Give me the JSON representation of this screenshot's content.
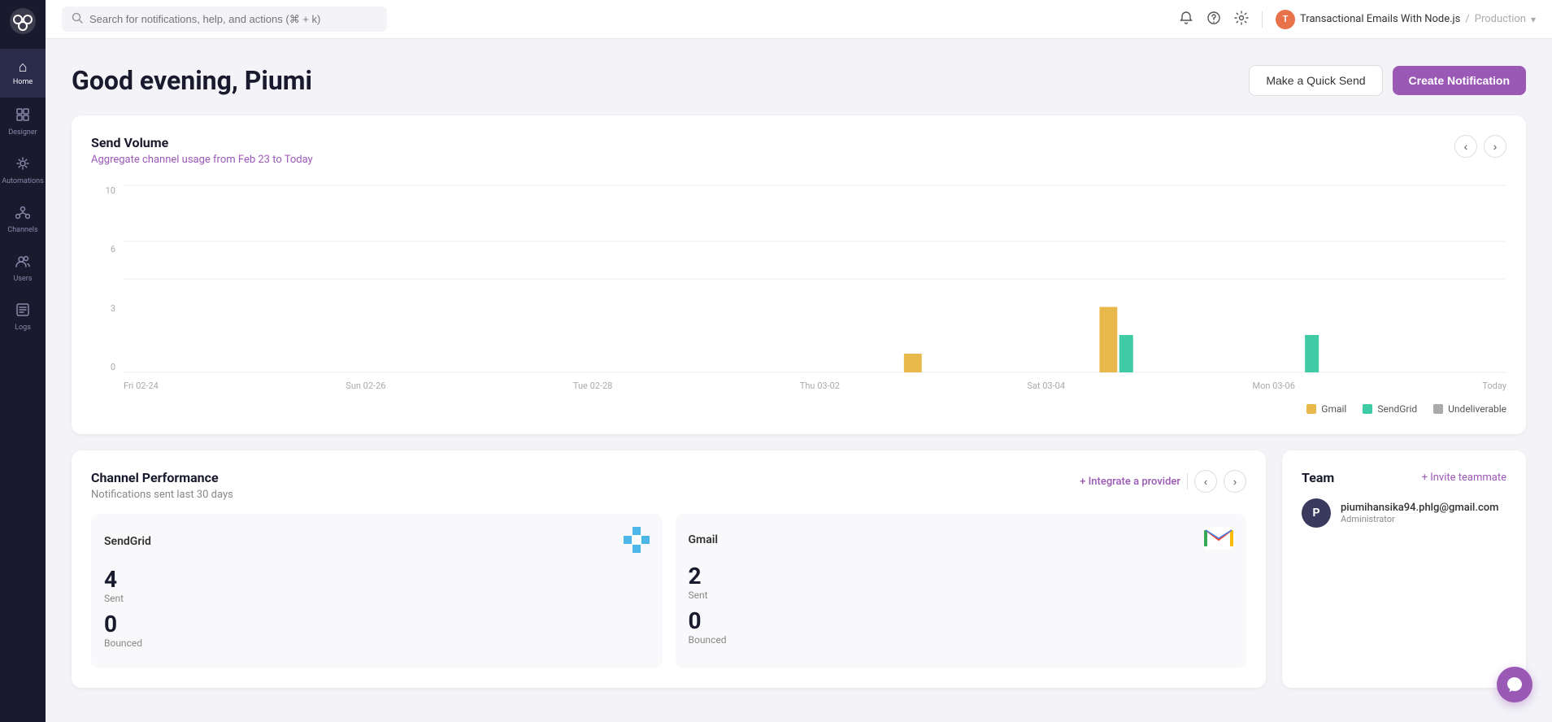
{
  "sidebar": {
    "logo_label": "N",
    "items": [
      {
        "id": "home",
        "label": "Home",
        "icon": "⌂",
        "active": true
      },
      {
        "id": "designer",
        "label": "Designer",
        "icon": "◈",
        "active": false
      },
      {
        "id": "automations",
        "label": "Automations",
        "icon": "⟳",
        "active": false
      },
      {
        "id": "channels",
        "label": "Channels",
        "icon": "⊕",
        "active": false
      },
      {
        "id": "users",
        "label": "Users",
        "icon": "👥",
        "active": false
      },
      {
        "id": "logs",
        "label": "Logs",
        "icon": "🗄",
        "active": false
      }
    ]
  },
  "topbar": {
    "search_placeholder": "Search for notifications, help, and actions (⌘ + k)",
    "search_shortcut": "⌘ + k",
    "workspace_name": "Transactional Emails With Node.js",
    "workspace_env": "Production",
    "avatar_letter": "T"
  },
  "page": {
    "greeting": "Good evening, Piumi",
    "quick_send_label": "Make a Quick Send",
    "create_notification_label": "Create Notification"
  },
  "send_volume": {
    "title": "Send Volume",
    "subtitle_prefix": "Aggregate channel usage from ",
    "date_range": "Feb 23 to Today",
    "y_labels": [
      "10",
      "6",
      "3",
      "0"
    ],
    "x_labels": [
      "Fri 02-24",
      "Sun 02-26",
      "Tue 02-28",
      "Thu 03-02",
      "Sat 03-04",
      "Mon 03-06",
      "Today"
    ],
    "legend": [
      {
        "label": "Gmail",
        "color": "#e8b84b"
      },
      {
        "label": "SendGrid",
        "color": "#3ecba5"
      },
      {
        "label": "Undeliverable",
        "color": "#aaa"
      }
    ],
    "bars": [
      {
        "x_index": 4,
        "gmail": 1,
        "sendgrid": 0,
        "max": 10
      },
      {
        "x_index": 5,
        "gmail": 3.5,
        "sendgrid": 2,
        "max": 10
      },
      {
        "x_index": 6,
        "gmail": 0,
        "sendgrid": 2,
        "max": 10
      }
    ]
  },
  "channel_performance": {
    "title": "Channel Performance",
    "subtitle": "Notifications sent last 30 days",
    "integrate_label": "+ Integrate a provider",
    "channels": [
      {
        "name": "SendGrid",
        "logo": "sendgrid",
        "sent_value": "4",
        "sent_label": "Sent",
        "other_value": "0",
        "other_label": "Bounced"
      },
      {
        "name": "Gmail",
        "logo": "gmail",
        "sent_value": "2",
        "sent_label": "Sent",
        "other_value": "0",
        "other_label": "Bounced"
      }
    ]
  },
  "team": {
    "title": "Team",
    "invite_label": "+ Invite teammate",
    "members": [
      {
        "avatar_letter": "P",
        "email": "piumihansika94.phlg@gmail.com",
        "role": "Administrator"
      }
    ]
  },
  "chat": {
    "icon": "💬"
  }
}
